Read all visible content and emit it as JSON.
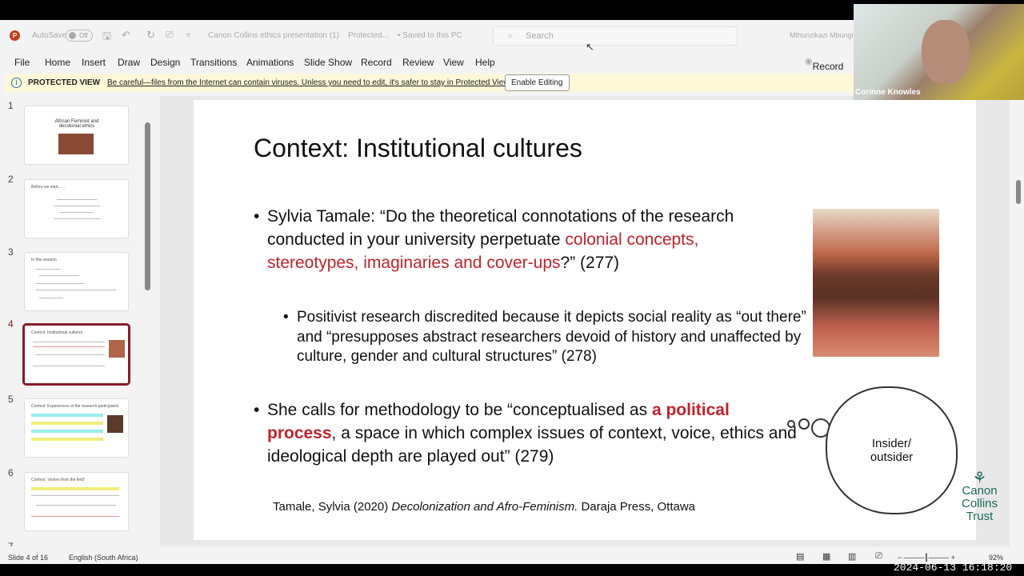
{
  "titlebar": {
    "autosave": "AutoSave",
    "toggle": "Off",
    "filename": "Canon Collins ethics presentation (1)",
    "protected": "Protected...",
    "saved": "• Saved to this PC",
    "search_placeholder": "Search",
    "user": "Mthunzikazi Mbungi"
  },
  "menu": [
    "File",
    "Home",
    "Insert",
    "Draw",
    "Design",
    "Transitions",
    "Animations",
    "Slide Show",
    "Record",
    "Review",
    "View",
    "Help"
  ],
  "record_button": "Record",
  "protected_bar": {
    "label": "PROTECTED VIEW",
    "message": "Be careful—files from the Internet can contain viruses. Unless you need to edit, it's safer to stay in Protected View.",
    "button": "Enable Editing"
  },
  "thumbnails": [
    {
      "num": "1",
      "title": "African Feminist and decolonial ethics"
    },
    {
      "num": "2",
      "title": "Before we start......"
    },
    {
      "num": "3",
      "title": "In this session"
    },
    {
      "num": "4",
      "title": "Context: Institutional cultures",
      "selected": true
    },
    {
      "num": "5",
      "title": "Context: Experiences of the research participants"
    },
    {
      "num": "6",
      "title": "Context: 'stories from the field'"
    },
    {
      "num": "7",
      "title": ""
    }
  ],
  "slide": {
    "title": "Context: Institutional cultures",
    "b1_a": "Sylvia Tamale: “Do the theoretical connotations of the research conducted in your university perpetuate ",
    "b1_red": "colonial concepts, stereotypes, imaginaries and cover-ups",
    "b1_c": "?” (277)",
    "sub": "Positivist research discredited because it depicts social reality as “out there” and “presupposes abstract researchers devoid of history and unaffected by culture, gender and cultural structures” (278)",
    "b2_a": "She calls for methodology to be “conceptualised as ",
    "b2_red": "a political process",
    "b2_c": ", a space in which complex issues of context, voice, ethics and ideological depth are played out” (279)",
    "cloud": "Insider/ outsider",
    "ref_a": "Tamale, Sylvia (2020) ",
    "ref_i": "Decolonization and Afro-Feminism.",
    "ref_b": " Daraja Press, Ottawa",
    "logo": [
      "Canon",
      "Collins",
      "Trust"
    ]
  },
  "status": {
    "slide": "Slide 4 of 16",
    "language": "English (South Africa)",
    "zoom": "92%"
  },
  "video": {
    "name": "Corinne Knowles"
  },
  "timestamp": "2024-06-13 16:18:20",
  "colors": {
    "accent_red": "#c0232b",
    "selected_thumb": "#8a1b2b",
    "logo_green": "#1c6a5a"
  }
}
